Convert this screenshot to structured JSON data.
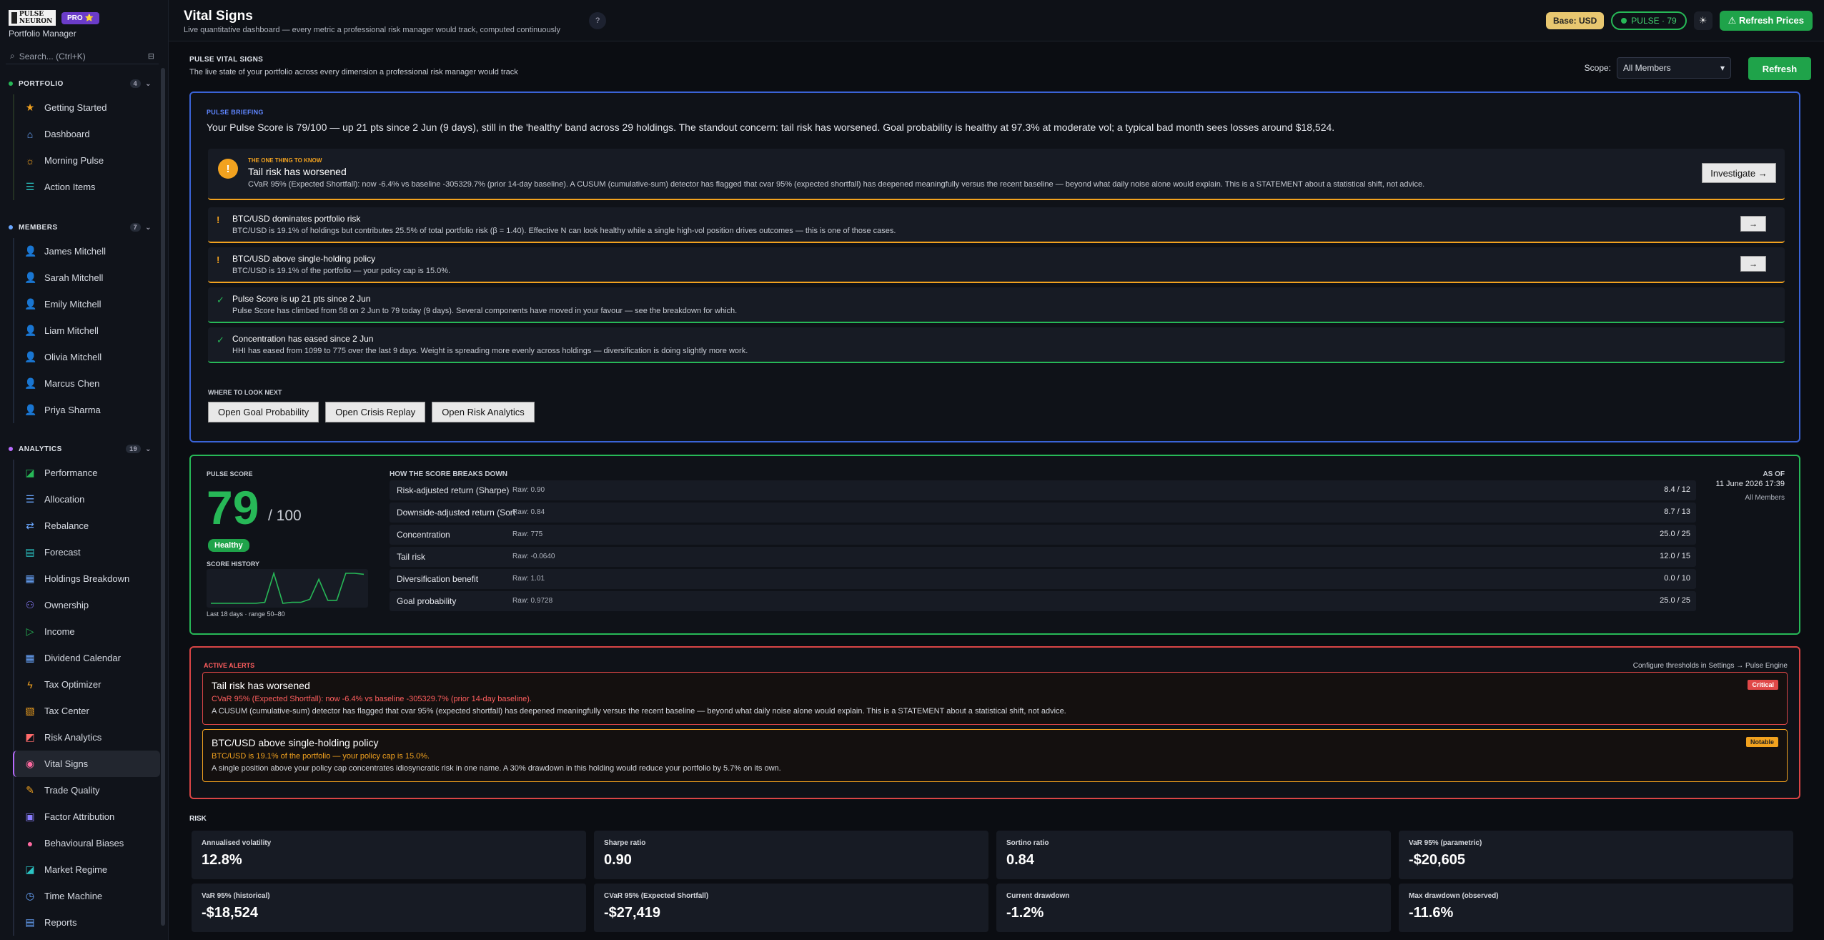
{
  "app": {
    "logo_text": "PULSE NEURON",
    "plan_badge": "PRO ⭐",
    "subtitle": "Portfolio Manager"
  },
  "search": {
    "placeholder": "Search... (Ctrl+K)"
  },
  "sidebar": {
    "portfolio": {
      "title": "PORTFOLIO",
      "count": "4",
      "color": "#27b857",
      "items": [
        {
          "label": "Getting Started",
          "icon": "★",
          "color": "#f2a21f"
        },
        {
          "label": "Dashboard",
          "icon": "⌂",
          "color": "#6aa7ff"
        },
        {
          "label": "Morning Pulse",
          "icon": "☼",
          "color": "#f2a21f"
        },
        {
          "label": "Action Items",
          "icon": "☰",
          "color": "#2bc4c4"
        }
      ]
    },
    "members": {
      "title": "MEMBERS",
      "count": "7",
      "color": "#6aa7ff",
      "items": [
        {
          "label": "James Mitchell",
          "icon": "👤",
          "color": "#8a7dff"
        },
        {
          "label": "Sarah Mitchell",
          "icon": "👤",
          "color": "#27b857"
        },
        {
          "label": "Emily Mitchell",
          "icon": "👤",
          "color": "#6aa7ff"
        },
        {
          "label": "Liam Mitchell",
          "icon": "👤",
          "color": "#ff6a6a"
        },
        {
          "label": "Olivia Mitchell",
          "icon": "👤",
          "color": "#ff6a6a"
        },
        {
          "label": "Marcus Chen",
          "icon": "👤",
          "color": "#2bc4c4"
        },
        {
          "label": "Priya Sharma",
          "icon": "👤",
          "color": "#ff6a6a"
        }
      ]
    },
    "analytics": {
      "title": "ANALYTICS",
      "count": "19",
      "color": "#b86bff",
      "items": [
        {
          "label": "Performance",
          "icon": "◪",
          "color": "#27b857"
        },
        {
          "label": "Allocation",
          "icon": "☰",
          "color": "#6aa7ff"
        },
        {
          "label": "Rebalance",
          "icon": "⇄",
          "color": "#6aa7ff"
        },
        {
          "label": "Forecast",
          "icon": "▤",
          "color": "#2bc4c4"
        },
        {
          "label": "Holdings Breakdown",
          "icon": "▦",
          "color": "#6aa7ff"
        },
        {
          "label": "Ownership",
          "icon": "⚇",
          "color": "#8a7dff"
        },
        {
          "label": "Income",
          "icon": "▷",
          "color": "#27b857"
        },
        {
          "label": "Dividend Calendar",
          "icon": "▦",
          "color": "#6aa7ff"
        },
        {
          "label": "Tax Optimizer",
          "icon": "ϟ",
          "color": "#f2a21f"
        },
        {
          "label": "Tax Center",
          "icon": "▧",
          "color": "#f2a21f"
        },
        {
          "label": "Risk Analytics",
          "icon": "◩",
          "color": "#ff6a6a"
        },
        {
          "label": "Vital Signs",
          "icon": "◉",
          "color": "#ff6aa0"
        },
        {
          "label": "Trade Quality",
          "icon": "✎",
          "color": "#f2a21f"
        },
        {
          "label": "Factor Attribution",
          "icon": "▣",
          "color": "#8a7dff"
        },
        {
          "label": "Behavioural Biases",
          "icon": "●",
          "color": "#ff6aa0"
        },
        {
          "label": "Market Regime",
          "icon": "◪",
          "color": "#2bc4c4"
        },
        {
          "label": "Time Machine",
          "icon": "◷",
          "color": "#6aa7ff"
        },
        {
          "label": "Reports",
          "icon": "▤",
          "color": "#6aa7ff"
        }
      ]
    }
  },
  "header": {
    "title": "Vital Signs",
    "subtitle": "Live quantitative dashboard — every metric a professional risk manager would track, computed continuously",
    "help": "?",
    "base": "Base: USD",
    "pulse": "PULSE · 79",
    "theme_icon": "☀",
    "refresh_prices": "⚠ Refresh Prices"
  },
  "vital": {
    "title": "PULSE VITAL SIGNS",
    "subtitle": "The live state of your portfolio across every dimension a professional risk manager would track",
    "scope_label": "Scope:",
    "scope_value": "All Members",
    "refresh": "Refresh"
  },
  "briefing": {
    "label": "PULSE BRIEFING",
    "text": "Your Pulse Score is 79/100 — up 21 pts since 2 Jun (9 days), still in the 'healthy' band across 29 holdings. The standout concern: tail risk has worsened. Goal probability is healthy at 97.3% at moderate vol; a typical bad month sees losses around $18,524.",
    "one_thing": {
      "label": "THE ONE THING TO KNOW",
      "icon": "!",
      "title": "Tail risk has worsened",
      "text": "CVaR 95% (Expected Shortfall): now -6.4% vs baseline -305329.7% (prior 14-day baseline). A CUSUM (cumulative-sum) detector has flagged that cvar 95% (expected shortfall) has deepened meaningfully versus the recent baseline — beyond what daily noise alone would explain. This is a STATEMENT about a statistical shift, not advice.",
      "button": "Investigate →"
    },
    "items": [
      {
        "icon": "!",
        "title": "BTC/USD dominates portfolio risk",
        "text": "BTC/USD is 19.1% of holdings but contributes 25.5% of total portfolio risk (β = 1.40). Effective N can look healthy while a single high-vol position drives outcomes — this is one of those cases.",
        "button": "→"
      },
      {
        "icon": "!",
        "title": "BTC/USD above single-holding policy",
        "text": "BTC/USD is 19.1% of the portfolio — your policy cap is 15.0%.",
        "button": "→"
      },
      {
        "icon": "✓",
        "title": "Pulse Score is up 21 pts since 2 Jun",
        "text": "Pulse Score has climbed from 58 on 2 Jun to 79 today (9 days). Several components have moved in your favour — see the breakdown for which."
      },
      {
        "icon": "✓",
        "title": "Concentration has eased since 2 Jun",
        "text": "HHI has eased from 1099 to 775 over the last 9 days. Weight is spreading more evenly across holdings — diversification is doing slightly more work."
      }
    ],
    "where_label": "WHERE TO LOOK NEXT",
    "where_buttons": [
      "Open Goal Probability",
      "Open Crisis Replay",
      "Open Risk Analytics"
    ]
  },
  "score": {
    "label": "PULSE SCORE",
    "value": "79",
    "denominator": "/ 100",
    "band": "Healthy",
    "history_label": "SCORE HISTORY",
    "history_note": "Last 18 days · range 50–80",
    "history": [
      50,
      50,
      50,
      50,
      50,
      50,
      51,
      80,
      50,
      51,
      51,
      54,
      74,
      53,
      53,
      80,
      80,
      79
    ],
    "breakdown_label": "HOW THE SCORE BREAKS DOWN",
    "rows": [
      {
        "name": "Risk-adjusted return (Sharpe)",
        "raw": "Raw: 0.90",
        "pts": "8.4  /  12"
      },
      {
        "name": "Downside-adjusted return (Sort",
        "raw": "Raw: 0.84",
        "pts": "8.7  /  13"
      },
      {
        "name": "Concentration",
        "raw": "Raw: 775",
        "pts": "25.0  /  25"
      },
      {
        "name": "Tail risk",
        "raw": "Raw: -0.0640",
        "pts": "12.0  /  15"
      },
      {
        "name": "Diversification benefit",
        "raw": "Raw: 1.01",
        "pts": "0.0  /  10"
      },
      {
        "name": "Goal probability",
        "raw": "Raw: 0.9728",
        "pts": "25.0  /  25"
      }
    ],
    "asof_label": "AS OF",
    "asof_date": "11 June 2026 17:39",
    "asof_scope": "All Members"
  },
  "alerts": {
    "label": "ACTIVE ALERTS",
    "config": "Configure thresholds in Settings → Pulse Engine",
    "items": [
      {
        "title": "Tail risk has worsened",
        "line": "CVaR 95% (Expected Shortfall): now -6.4% vs baseline -305329.7% (prior 14-day baseline).",
        "text": "A CUSUM (cumulative-sum) detector has flagged that cvar 95% (expected shortfall) has deepened meaningfully versus the recent baseline — beyond what daily noise alone would explain. This is a STATEMENT about a statistical shift, not advice.",
        "badge": "Critical"
      },
      {
        "title": "BTC/USD above single-holding policy",
        "line": "BTC/USD is 19.1% of the portfolio — your policy cap is 15.0%.",
        "text": "A single position above your policy cap concentrates idiosyncratic risk in one name. A 30% drawdown in this holding would reduce your portfolio by 5.7% on its own.",
        "badge": "Notable"
      }
    ]
  },
  "risk": {
    "label": "RISK",
    "metrics": [
      {
        "label": "Annualised volatility",
        "value": "12.8%"
      },
      {
        "label": "Sharpe ratio",
        "value": "0.90"
      },
      {
        "label": "Sortino ratio",
        "value": "0.84"
      },
      {
        "label": "VaR 95% (parametric)",
        "value": "-$20,605"
      },
      {
        "label": "VaR 95% (historical)",
        "value": "-$18,524"
      },
      {
        "label": "CVaR 95% (Expected Shortfall)",
        "value": "-$27,419"
      },
      {
        "label": "Current drawdown",
        "value": "-1.2%"
      },
      {
        "label": "Max drawdown (observed)",
        "value": "-11.6%"
      }
    ]
  }
}
